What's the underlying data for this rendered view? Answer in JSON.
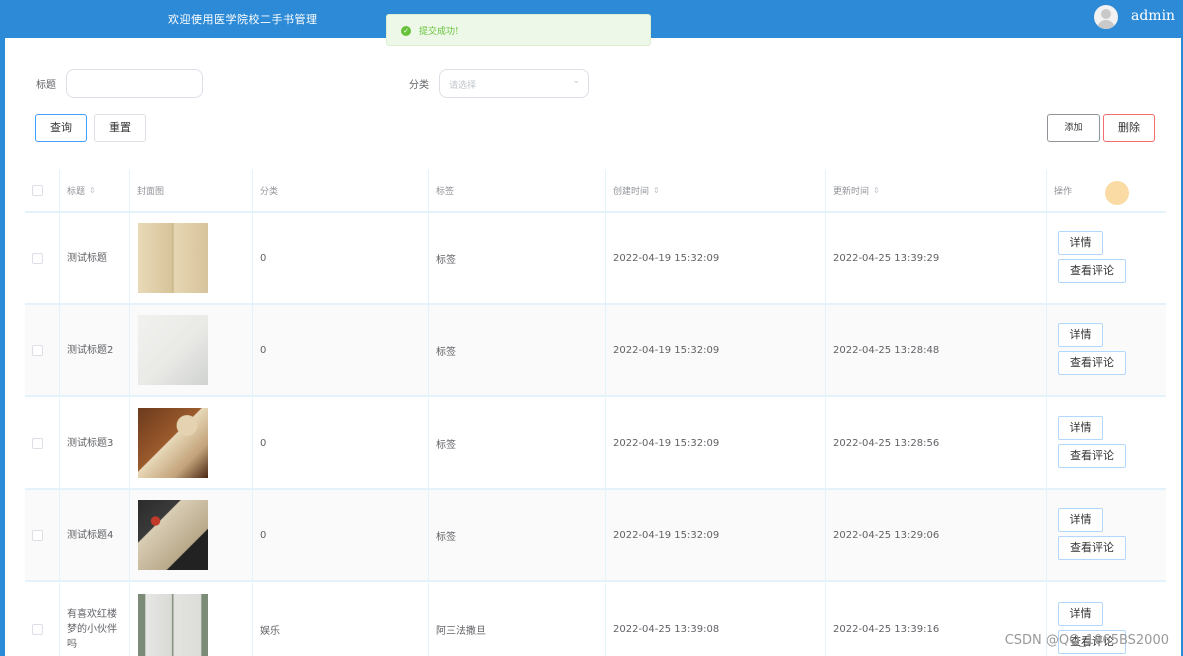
{
  "header": {
    "app_title": "欢迎使用医学院校二手书管理",
    "user_name": "admin"
  },
  "toast": {
    "message": "提交成功!"
  },
  "filters": {
    "title_label": "标题",
    "title_value": "",
    "category_label": "分类",
    "category_placeholder": "请选择"
  },
  "buttons": {
    "search": "查询",
    "reset": "重置",
    "add": "添加",
    "delete": "删除"
  },
  "table": {
    "columns": [
      "标题",
      "封面图",
      "分类",
      "标签",
      "创建时间",
      "更新时间",
      "操作"
    ],
    "rows": [
      {
        "title": "测试标题",
        "category": "0",
        "tag": "标签",
        "created": "2022-04-19 15:32:09",
        "updated": "2022-04-25 13:39:29",
        "detail": "详情",
        "comments": "查看评论"
      },
      {
        "title": "测试标题2",
        "category": "0",
        "tag": "标签",
        "created": "2022-04-19 15:32:09",
        "updated": "2022-04-25 13:28:48",
        "detail": "详情",
        "comments": "查看评论"
      },
      {
        "title": "测试标题3",
        "category": "0",
        "tag": "标签",
        "created": "2022-04-19 15:32:09",
        "updated": "2022-04-25 13:28:56",
        "detail": "详情",
        "comments": "查看评论"
      },
      {
        "title": "测试标题4",
        "category": "0",
        "tag": "标签",
        "created": "2022-04-19 15:32:09",
        "updated": "2022-04-25 13:29:06",
        "detail": "详情",
        "comments": "查看评论"
      },
      {
        "title": "有喜欢红楼梦的小伙伴吗",
        "category": "娱乐",
        "tag": "阿三法撒旦",
        "created": "2022-04-25 13:39:08",
        "updated": "2022-04-25 13:39:16",
        "detail": "详情",
        "comments": "查看评论"
      }
    ]
  },
  "watermark": "CSDN @QQ_1065BS2000",
  "colors": {
    "header": "#2d8ad6",
    "success": "#67c23a",
    "border": "#e3f2fb"
  }
}
